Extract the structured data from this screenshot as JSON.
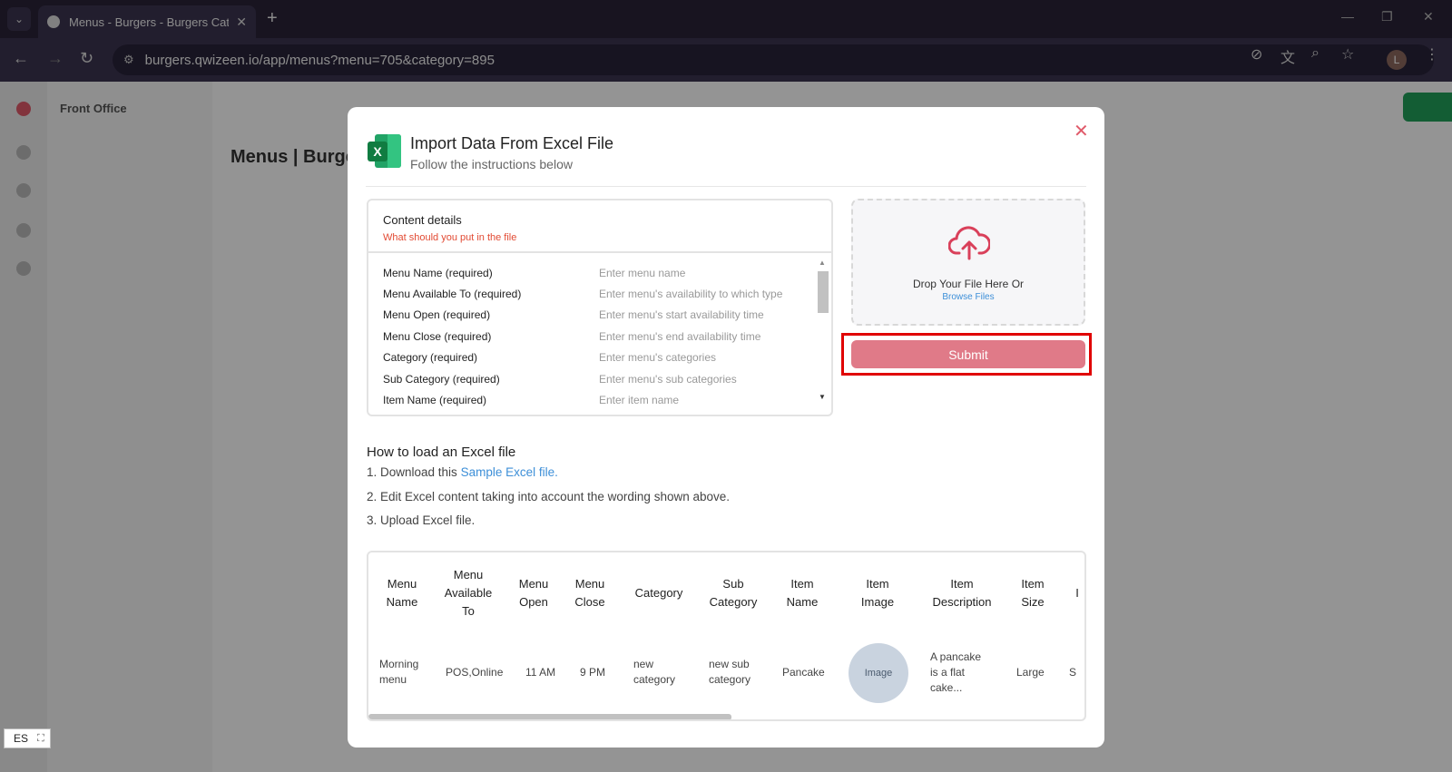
{
  "browser": {
    "tab_title": "Menus - Burgers - Burgers Category",
    "url": "burgers.qwizeen.io/app/menus?menu=705&category=895",
    "profile_initial": "L"
  },
  "background": {
    "sidebar_title": "Front Office",
    "page_heading": "Menus | Burgers"
  },
  "modal": {
    "title": "Import Data From Excel File",
    "subtitle": "Follow the instructions below",
    "content_details": {
      "title": "Content details",
      "subtitle": "What should you put in the file",
      "rows": [
        {
          "field": "Menu Name (required)",
          "hint": "Enter menu name"
        },
        {
          "field": "Menu Available To (required)",
          "hint": "Enter menu's availability to which type"
        },
        {
          "field": "Menu Open (required)",
          "hint": "Enter menu's start availability time"
        },
        {
          "field": "Menu Close (required)",
          "hint": "Enter menu's end availability time"
        },
        {
          "field": "Category (required)",
          "hint": "Enter menu's categories"
        },
        {
          "field": "Sub Category (required)",
          "hint": "Enter menu's sub categories"
        },
        {
          "field": "Item Name (required)",
          "hint": "Enter item name"
        }
      ]
    },
    "dropzone": {
      "text": "Drop Your File Here Or",
      "browse": "Browse Files"
    },
    "submit_label": "Submit",
    "howto": {
      "title": "How to load an Excel file",
      "step1_prefix": "1. Download this ",
      "step1_link": "Sample Excel file.",
      "step2": "2. Edit Excel content taking into account the wording shown above.",
      "step3": "3. Upload Excel file."
    },
    "preview": {
      "headers": [
        "Menu Name",
        "Menu Available To",
        "Menu Open",
        "Menu Close",
        "Category",
        "Sub Category",
        "Item Name",
        "Item Image",
        "Item Description",
        "Item Size",
        "I"
      ],
      "row": [
        "Morning menu",
        "POS,Online",
        "11 AM",
        "9 PM",
        "new category",
        "new sub category",
        "Pancake",
        "Image",
        "A pancake is a flat cake...",
        "Large",
        "S"
      ]
    }
  },
  "language": "ES",
  "colors": {
    "accent": "#e07a88",
    "highlight": "#e00000",
    "link": "#3d8fd8",
    "excel_green": "#107c41"
  }
}
